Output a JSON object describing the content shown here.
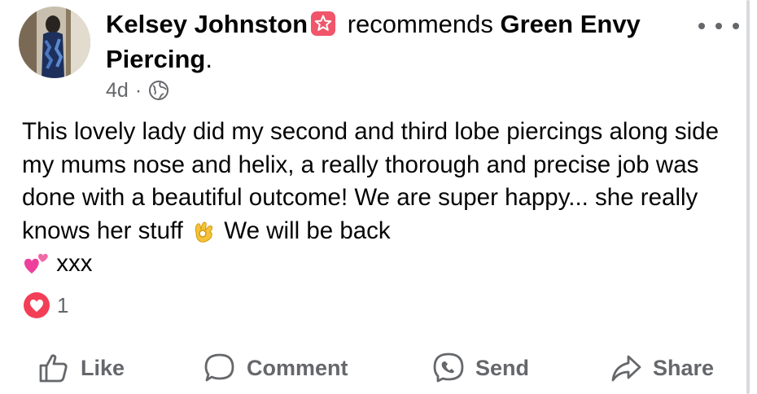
{
  "post": {
    "author": "Kelsey Johnston",
    "action_text": "recommends",
    "page_name_line1": "Green Envy",
    "page_name_line2": "Piercing",
    "page_name_suffix": ".",
    "timestamp": "4d",
    "separator": "·",
    "body_text": "This lovely lady did my second and third lobe piercings along side my mums nose and helix, a really thorough and precise job was done with a beautiful outcome! We are super happy... she really knows her stuff ",
    "body_text_after_emoji": " We will be back ",
    "body_text_end": " xxx"
  },
  "reactions": {
    "count": "1"
  },
  "actions": {
    "like": "Like",
    "comment": "Comment",
    "send": "Send",
    "share": "Share"
  },
  "colors": {
    "secondary_text": "#65676b",
    "recommend_badge": "#f0556a",
    "love_reaction": "#f33e58"
  },
  "icons": {
    "badge": "star-icon",
    "privacy": "globe-icon",
    "more": "more-horizontal-icon",
    "reaction": "love-reaction-icon",
    "like": "thumbs-up-icon",
    "comment": "comment-bubble-icon",
    "send": "messenger-icon",
    "share": "share-arrow-icon"
  }
}
